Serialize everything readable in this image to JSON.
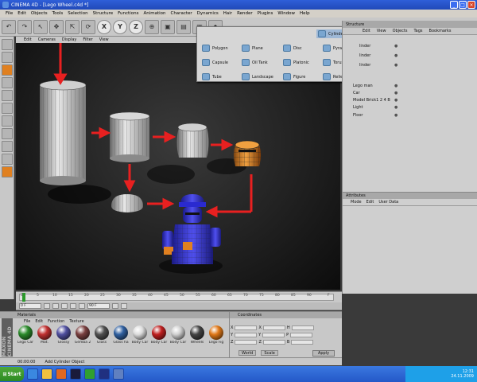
{
  "window": {
    "title": "CINEMA 4D - [Lego Wheel.c4d *]"
  },
  "menu": [
    "File",
    "Edit",
    "Objects",
    "Tools",
    "Selection",
    "Structure",
    "Functions",
    "Animation",
    "Character",
    "Dynamics",
    "Hair",
    "Render",
    "Plugins",
    "Window",
    "Help"
  ],
  "toolbar": {
    "axes": [
      "X",
      "Y",
      "Z"
    ]
  },
  "viewport": {
    "menu": [
      "Edit",
      "Cameras",
      "Display",
      "Filter",
      "View"
    ]
  },
  "dropdown": {
    "items": [
      {
        "label": "Cylinder",
        "selected": true
      },
      {
        "label": "Polygon"
      },
      {
        "label": "Plane"
      },
      {
        "label": "Disc"
      },
      {
        "label": "Pyramid"
      },
      {
        "label": "Capsule"
      },
      {
        "label": "Oil Tank"
      },
      {
        "label": "Platonic"
      },
      {
        "label": "Torus"
      },
      {
        "label": "Tube"
      },
      {
        "label": "Landscape"
      },
      {
        "label": "Figure"
      },
      {
        "label": "Relief"
      }
    ]
  },
  "objects": {
    "title": "Structure",
    "menu": [
      "Edit",
      "View",
      "Objects",
      "Tags",
      "Bookmarks"
    ],
    "rows": [
      "linder",
      "linder",
      "linder",
      "Lego man",
      "Car",
      "Model Brick1 2 4 B",
      "Light",
      "Floor"
    ]
  },
  "attributes": {
    "title": "Attributes",
    "menu": [
      "Mode",
      "Edit",
      "User Data"
    ]
  },
  "timeline": {
    "ticks": [
      "0",
      "5",
      "10",
      "15",
      "20",
      "25",
      "30",
      "35",
      "40",
      "45",
      "50",
      "55",
      "60",
      "65",
      "70",
      "75",
      "80",
      "85",
      "90",
      "F"
    ],
    "frame_start": "0 F",
    "frame_end": "90 F"
  },
  "materials": {
    "title": "Materials",
    "menu": [
      "File",
      "Edit",
      "Function",
      "Texture"
    ],
    "items": [
      {
        "label": "Lego Car",
        "color": "#2a8a2a"
      },
      {
        "label": "Mat.",
        "color": "#c03030"
      },
      {
        "label": "Glossy",
        "color": "#5050a0"
      },
      {
        "label": "Gemba 2",
        "color": "#7a4040"
      },
      {
        "label": "Glass",
        "color": "#505050"
      },
      {
        "label": "Glass ha",
        "color": "#3060a0"
      },
      {
        "label": "Body Car",
        "color": "#dcdcdc"
      },
      {
        "label": "Body Car",
        "color": "#c02020"
      },
      {
        "label": "Body Car",
        "color": "#d0d0d0"
      },
      {
        "label": "Wheels",
        "color": "#444444"
      },
      {
        "label": "Lego Fig",
        "color": "#e07818"
      }
    ],
    "brand": "MAXON CINEMA 4D"
  },
  "coordinates": {
    "title": "Coordinates",
    "rows": [
      [
        "X",
        "X",
        "H"
      ],
      [
        "Y",
        "Y",
        "P"
      ],
      [
        "Z",
        "Z",
        "B"
      ]
    ],
    "modes": [
      "World",
      "Scale"
    ],
    "apply": "Apply"
  },
  "status": {
    "time": "00:00:00",
    "message": "Add Cylinder Object"
  },
  "taskbar": {
    "start": "Start",
    "clock": "12:31",
    "date": "24.11.2009"
  },
  "colors": {
    "accent_red": "#e82020",
    "orange": "#e07818",
    "blue_figure": "#3a3ad8"
  }
}
